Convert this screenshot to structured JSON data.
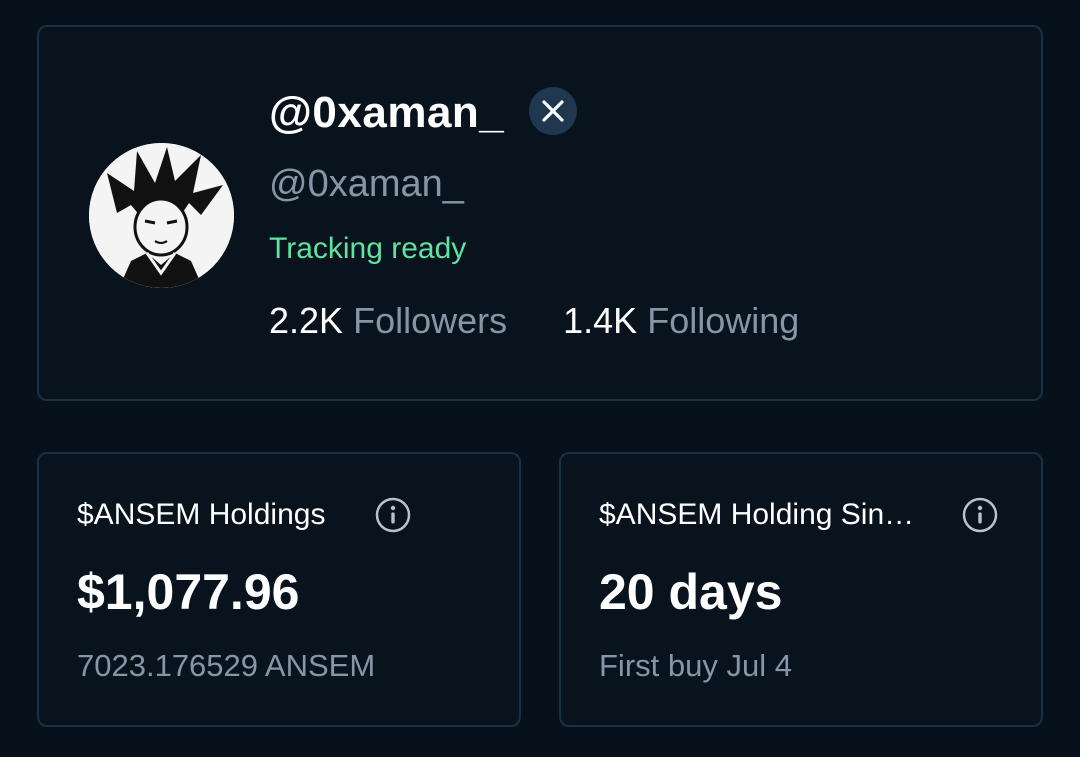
{
  "profile": {
    "display_name": "@0xaman_",
    "handle": "@0xaman_",
    "status": "Tracking ready",
    "followers_count": "2.2K",
    "followers_label": "Followers",
    "following_count": "1.4K",
    "following_label": "Following",
    "social_badge_icon": "x-logo-icon",
    "avatar_icon": "anime-character-avatar"
  },
  "holdings": {
    "title": "$ANSEM Holdings",
    "value": "$1,077.96",
    "sub": "7023.176529 ANSEM",
    "info_icon": "info-icon"
  },
  "holding_since": {
    "title": "$ANSEM Holding Sin…",
    "value": "20 days",
    "sub": "First buy Jul 4",
    "info_icon": "info-icon"
  },
  "colors": {
    "background": "#07111b",
    "card_border": "#1b3044",
    "muted_text": "#8795a6",
    "status_green": "#5fe3a1",
    "badge_bg": "#1f3850"
  }
}
